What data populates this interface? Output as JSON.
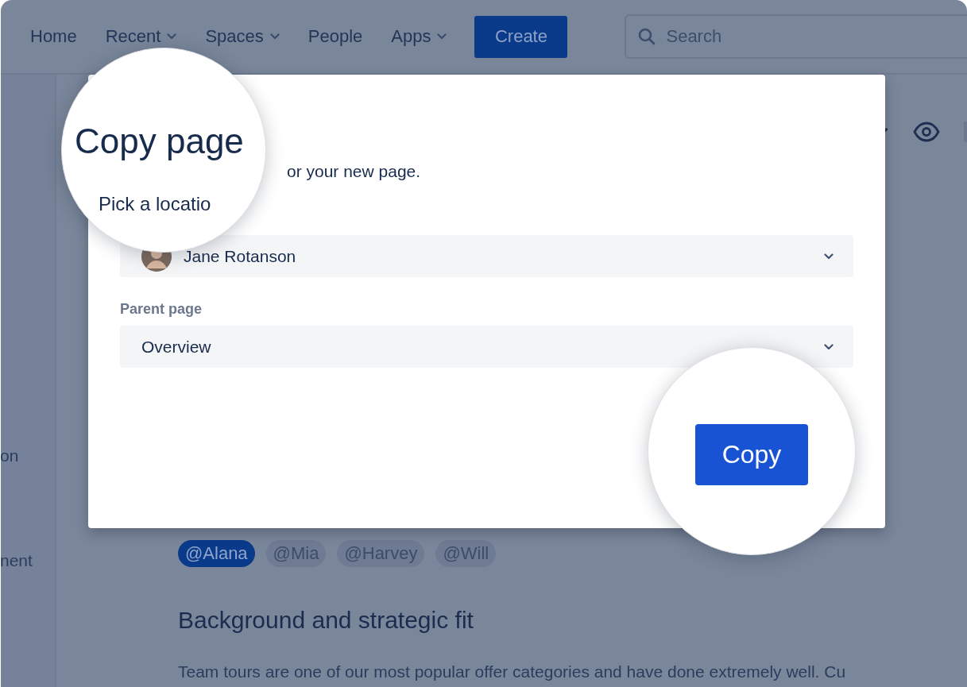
{
  "nav": {
    "items": [
      {
        "label": "Home",
        "dropdown": false
      },
      {
        "label": "Recent",
        "dropdown": true
      },
      {
        "label": "Spaces",
        "dropdown": true
      },
      {
        "label": "People",
        "dropdown": false
      },
      {
        "label": "Apps",
        "dropdown": true
      }
    ],
    "create_button": "Create",
    "search": {
      "placeholder": "Search"
    }
  },
  "sidebar": {
    "items": [
      "on",
      "nent"
    ]
  },
  "page": {
    "mentions": [
      {
        "label": "@Alana",
        "selected": true
      },
      {
        "label": "@Mia",
        "selected": false
      },
      {
        "label": "@Harvey",
        "selected": false
      },
      {
        "label": "@Will",
        "selected": false
      }
    ],
    "heading": "Background and strategic fit",
    "paragraph": "Team tours are one of our most popular offer categories and have done extremely well. Cu"
  },
  "dialog": {
    "title": "Copy page",
    "description": "or your new page.",
    "location_label": "Pick a locatio",
    "space_select": {
      "value": "Jane Rotanson"
    },
    "parent_label": "Parent page",
    "parent_select": {
      "value": "Overview"
    },
    "copy_button": "Copy"
  }
}
